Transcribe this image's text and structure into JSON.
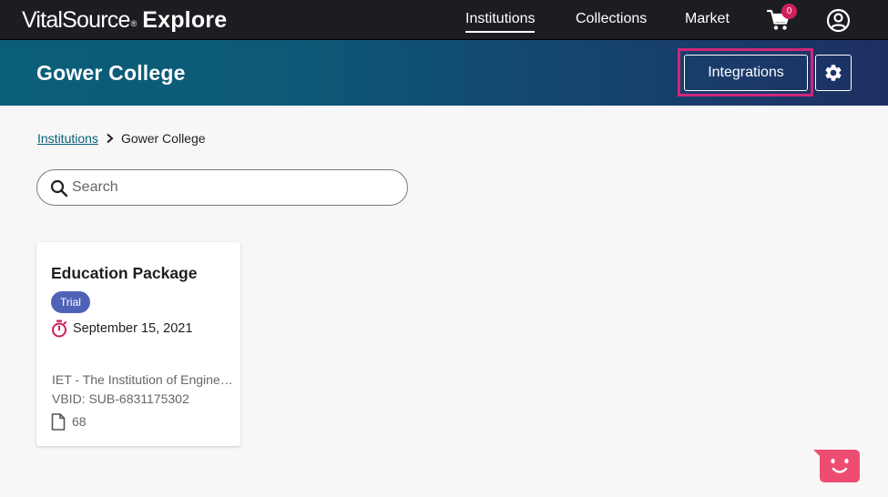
{
  "header": {
    "brand_main": "VitalSource",
    "brand_reg": "®",
    "brand_sub": "Explore",
    "nav": [
      {
        "label": "Institutions",
        "active": true
      },
      {
        "label": "Collections",
        "active": false
      },
      {
        "label": "Market",
        "active": false
      }
    ],
    "cart_count": "0",
    "cart_icon": "shopping-cart-icon",
    "account_icon": "user-account-icon"
  },
  "hero": {
    "title": "Gower College",
    "integrations_label": "Integrations",
    "settings_icon": "gear-icon"
  },
  "breadcrumb": {
    "parent": "Institutions",
    "current": "Gower College"
  },
  "search": {
    "placeholder": "Search",
    "value": ""
  },
  "cards": [
    {
      "title": "Education Package",
      "badge": "Trial",
      "date": "September 15, 2021",
      "publisher": "IET - The Institution of Engineering and Technology",
      "vbid": "VBID: SUB-6831175302",
      "pages": "68"
    }
  ],
  "colors": {
    "topbar": "#1b1d22",
    "hero_start": "#0b5e7a",
    "hero_end": "#1e2f63",
    "highlight": "#d0277a",
    "badge": "#5062b8",
    "timer": "#d0205c",
    "chat": "#ee4d72"
  }
}
